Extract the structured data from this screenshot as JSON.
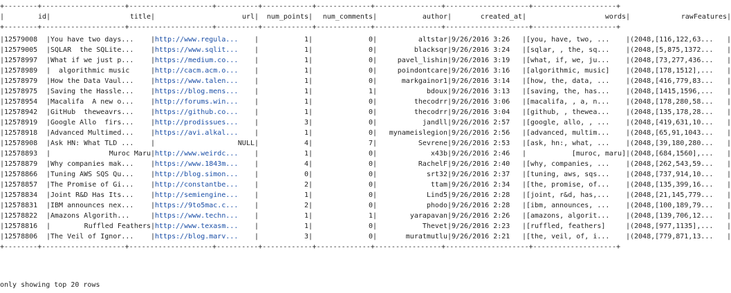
{
  "table": {
    "border_line": "+--------+--------------------+--------------------+----------+------------+-------------+----------------+--------------------+--------------------+",
    "columns": [
      "id",
      "title",
      "url",
      "num_points",
      "num_comments",
      "author",
      "created_at",
      "words",
      "rawFeatures"
    ],
    "rows": [
      [
        "12579008",
        "You have two days...",
        "http://www.regula...",
        "1",
        "0",
        "altstar",
        "9/26/2016 3:26",
        "[you, have, two, ...",
        "(2048,[116,122,63..."
      ],
      [
        "12579005",
        "SQLAR  the SQLite...",
        "https://www.sqlit...",
        "1",
        "0",
        "blacksqr",
        "9/26/2016 3:24",
        "[sqlar, , the, sq...",
        "(2048,[5,875,1372..."
      ],
      [
        "12578997",
        "What if we just p...",
        "https://medium.co...",
        "1",
        "0",
        "pavel_lishin",
        "9/26/2016 3:19",
        "[what, if, we, ju...",
        "(2048,[73,277,436..."
      ],
      [
        "12578989",
        "  algorithmic music",
        "http://cacm.acm.o...",
        "1",
        "0",
        "poindontcare",
        "9/26/2016 3:16",
        "[algorithmic, music]",
        "(2048,[178,1512],..."
      ],
      [
        "12578979",
        "How the Data Vaul...",
        "https://www.talen...",
        "1",
        "0",
        "markgainor1",
        "9/26/2016 3:14",
        "[how, the, data, ...",
        "(2048,[416,779,83..."
      ],
      [
        "12578975",
        "Saving the Hassle...",
        "https://blog.mens...",
        "1",
        "1",
        "bdoux",
        "9/26/2016 3:13",
        "[saving, the, has...",
        "(2048,[1415,1596,..."
      ],
      [
        "12578954",
        "Macalifa  A new o...",
        "http://forums.win...",
        "1",
        "0",
        "thecodrr",
        "9/26/2016 3:06",
        "[macalifa, , a, n...",
        "(2048,[178,280,58..."
      ],
      [
        "12578942",
        "GitHub  theweavrs...",
        "https://github.co...",
        "1",
        "0",
        "thecodrr",
        "9/26/2016 3:04",
        "[github, , thewea...",
        "(2048,[135,178,28..."
      ],
      [
        "12578919",
        "Google Allo  firs...",
        "http://prodissues...",
        "3",
        "0",
        "jandll",
        "9/26/2016 2:57",
        "[google, allo, , ...",
        "(2048,[419,631,10..."
      ],
      [
        "12578918",
        "Advanced Multimed...",
        "https://avi.alkal...",
        "1",
        "0",
        "mynameislegion",
        "9/26/2016 2:56",
        "[advanced, multim...",
        "(2048,[65,91,1043..."
      ],
      [
        "12578908",
        "Ask HN: What TLD ...",
        "NULL",
        "4",
        "7",
        "Sevrene",
        "9/26/2016 2:53",
        "[ask, hn:, what, ...",
        "(2048,[39,180,280..."
      ],
      [
        "12578893",
        "Muroc Maru",
        "http://www.weirdc...",
        "1",
        "0",
        "x43b",
        "9/26/2016 2:46",
        "[muroc, maru]",
        "(2048,[684,1560],..."
      ],
      [
        "12578879",
        "Why companies mak...",
        "https://www.1843m...",
        "4",
        "0",
        "RachelF",
        "9/26/2016 2:40",
        "[why, companies, ...",
        "(2048,[262,543,59..."
      ],
      [
        "12578866",
        "Tuning AWS SQS Qu...",
        "http://blog.simon...",
        "0",
        "0",
        "srt32",
        "9/26/2016 2:37",
        "[tuning, aws, sqs...",
        "(2048,[737,914,10..."
      ],
      [
        "12578857",
        "The Promise of Gi...",
        "http://constantbe...",
        "2",
        "0",
        "ttam",
        "9/26/2016 2:34",
        "[the, promise, of...",
        "(2048,[135,399,16..."
      ],
      [
        "12578834",
        "Joint R&D Has Its...",
        "http://semiengine...",
        "1",
        "0",
        "Lind5",
        "9/26/2016 2:28",
        "[joint, r&d, has,...",
        "(2048,[21,145,779..."
      ],
      [
        "12578831",
        "IBM announces nex...",
        "https://9to5mac.c...",
        "2",
        "0",
        "phodo",
        "9/26/2016 2:28",
        "[ibm, announces, ...",
        "(2048,[100,189,79..."
      ],
      [
        "12578822",
        "Amazons Algorith...",
        "https://www.techn...",
        "1",
        "1",
        "yarapavan",
        "9/26/2016 2:26",
        "[amazons, algorit...",
        "(2048,[139,706,12..."
      ],
      [
        "12578816",
        "Ruffled Feathers",
        "http://www.texasm...",
        "1",
        "0",
        "Thevet",
        "9/26/2016 2:23",
        "[ruffled, feathers]",
        "(2048,[977,1135],..."
      ],
      [
        "12578806",
        "The Veil of Ignor...",
        "https://blog.marv...",
        "3",
        "0",
        "muratmutlu",
        "9/26/2016 2:21",
        "[the, veil, of, i...",
        "(2048,[779,871,13..."
      ]
    ]
  },
  "footer": "only showing top 20 rows",
  "colors": {
    "text": "#222222",
    "url": "#1a4ea6",
    "background": "#ffffff"
  }
}
